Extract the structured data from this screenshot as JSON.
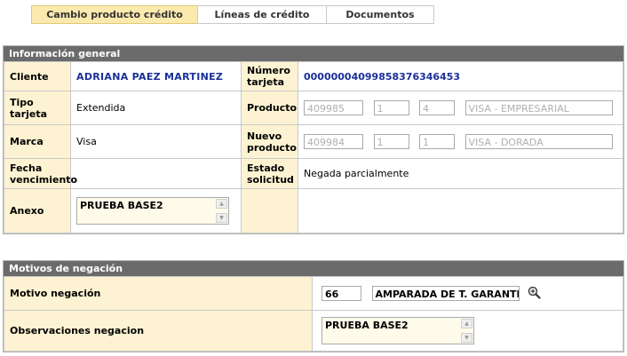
{
  "tabs": [
    {
      "label": "Cambio producto crédito"
    },
    {
      "label": "Líneas de crédito"
    },
    {
      "label": "Documentos"
    }
  ],
  "info": {
    "title": "Información general",
    "cliente_label": "Cliente",
    "cliente_value": "ADRIANA PAEZ MARTINEZ",
    "numero_tarjeta_label": "Número tarjeta",
    "numero_tarjeta_value": "0000000409985837634645 3",
    "tipo_tarjeta_label": "Tipo tarjeta",
    "tipo_tarjeta_value": "Extendida",
    "producto_label": "Producto",
    "producto_fields": [
      "409985",
      "1",
      "4",
      "VISA - EMPRESARIAL"
    ],
    "marca_label": "Marca",
    "marca_value": "Visa",
    "nuevo_producto_label": "Nuevo producto",
    "nuevo_producto_fields": [
      "409984",
      "1",
      "1",
      "VISA - DORADA"
    ],
    "fecha_vencimiento_label": "Fecha vencimiento",
    "fecha_vencimiento_value": "",
    "estado_solicitud_label": "Estado solicitud",
    "estado_solicitud_value": "Negada parcialmente",
    "anexo_label": "Anexo",
    "anexo_value": "PRUEBA BASE2"
  },
  "negacion": {
    "title": "Motivos de negación",
    "motivo_label": "Motivo negación",
    "motivo_code": "66",
    "motivo_desc": "AMPARADA DE T. GARANTIZADA",
    "observaciones_label": "Observaciones negacion",
    "observaciones_value": "PRUEBA BASE2"
  },
  "icons": {
    "search": "magnifier-plus-icon"
  }
}
